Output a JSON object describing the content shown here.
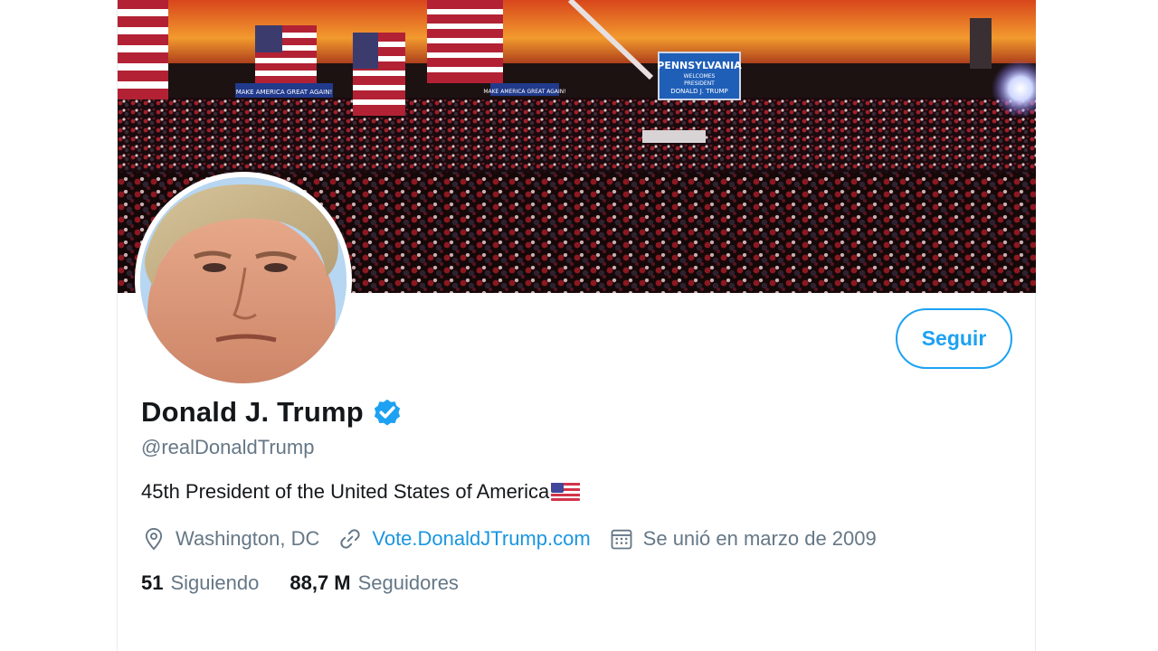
{
  "profile": {
    "name": "Donald J. Trump",
    "handle": "@realDonaldTrump",
    "bio": "45th President of the United States of America",
    "location": "Washington, DC",
    "website": "Vote.DonaldJTrump.com",
    "joined": "Se unió en marzo de 2009"
  },
  "actions": {
    "follow_label": "Seguir"
  },
  "stats": {
    "following_count": "51",
    "following_label": "Siguiendo",
    "followers_count": "88,7 M",
    "followers_label": "Seguidores"
  },
  "banner": {
    "sign_main": "PENNSYLVANIA",
    "sign_line2": "WELCOMES",
    "sign_line3": "PRESIDENT",
    "sign_line4": "DONALD J. TRUMP",
    "banner_left": "MAKE AMERICA GREAT AGAIN!",
    "banner_mid": "MAKE AMERICA GREAT AGAIN!"
  },
  "icons": {
    "verified": "verified-badge-icon",
    "location": "location-pin-icon",
    "link": "link-icon",
    "calendar": "calendar-icon",
    "flag": "us-flag-emoji"
  },
  "colors": {
    "accent": "#1da1f2",
    "link": "#1b95e0",
    "text_primary": "#14171a",
    "text_secondary": "#657786"
  }
}
